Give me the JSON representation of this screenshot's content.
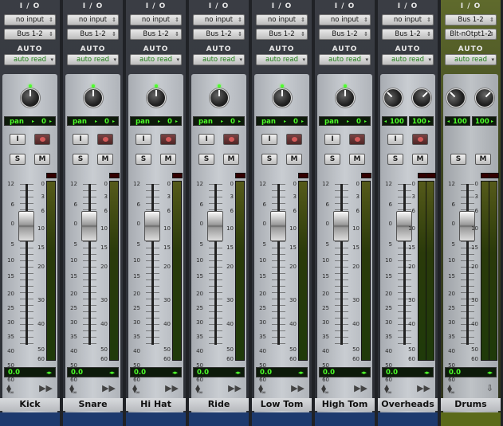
{
  "io_label": "I / O",
  "auto_label": "AUTO",
  "channels": [
    {
      "name": "Kick",
      "input": "no input",
      "output": "Bus 1-2",
      "automation": "auto read",
      "pan": [
        "pan",
        "0"
      ],
      "volume": "0.0"
    },
    {
      "name": "Snare",
      "input": "no input",
      "output": "Bus 1-2",
      "automation": "auto read",
      "pan": [
        "pan",
        "0"
      ],
      "volume": "0.0"
    },
    {
      "name": "Hi Hat",
      "input": "no input",
      "output": "Bus 1-2",
      "automation": "auto read",
      "pan": [
        "pan",
        "0"
      ],
      "volume": "0.0"
    },
    {
      "name": "Ride",
      "input": "no input",
      "output": "Bus 1-2",
      "automation": "auto read",
      "pan": [
        "pan",
        "0"
      ],
      "volume": "0.0"
    },
    {
      "name": "Low Tom",
      "input": "no input",
      "output": "Bus 1-2",
      "automation": "auto read",
      "pan": [
        "pan",
        "0"
      ],
      "volume": "0.0"
    },
    {
      "name": "High Tom",
      "input": "no input",
      "output": "Bus 1-2",
      "automation": "auto read",
      "pan": [
        "pan",
        "0"
      ],
      "volume": "0.0"
    },
    {
      "name": "Overheads",
      "input": "no input",
      "output": "Bus 1-2",
      "automation": "auto read",
      "pan": [
        "100",
        "100"
      ],
      "volume": "0.0"
    },
    {
      "name": "Drums",
      "input": "Bus 1-2",
      "output": "Blt-nOtpt1-2",
      "automation": "auto read",
      "pan": [
        "100",
        "100"
      ],
      "volume": "0.0"
    }
  ],
  "buttons": {
    "input": "I",
    "solo": "S",
    "mute": "M"
  },
  "fader_scale": [
    "12",
    "6",
    "0",
    "5",
    "10",
    "15",
    "20",
    "25",
    "30",
    "35",
    "40",
    "50",
    "60",
    "∞"
  ],
  "meter_scale": [
    "0",
    "3",
    "6",
    "10",
    "15",
    "20",
    "30",
    "40",
    "50",
    "60"
  ],
  "accent_green": "#4dff2a",
  "aux_color": "#5b6a1a",
  "track_color": "#1d3a6e"
}
